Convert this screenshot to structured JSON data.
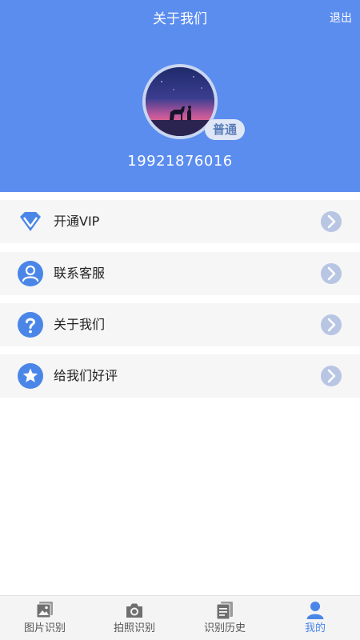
{
  "header": {
    "title": "关于我们",
    "logout_label": "退出"
  },
  "profile": {
    "level_badge": "普通",
    "phone": "19921876016"
  },
  "menu": {
    "items": [
      {
        "label": "开通VIP",
        "icon": "diamond-icon"
      },
      {
        "label": "联系客服",
        "icon": "user-icon"
      },
      {
        "label": "关于我们",
        "icon": "question-icon"
      },
      {
        "label": "给我们好评",
        "icon": "star-icon"
      }
    ]
  },
  "tabbar": {
    "tabs": [
      {
        "label": "图片识别",
        "icon": "image-icon"
      },
      {
        "label": "拍照识别",
        "icon": "camera-icon"
      },
      {
        "label": "识别历史",
        "icon": "history-icon"
      },
      {
        "label": "我的",
        "icon": "profile-icon",
        "active": true
      }
    ]
  },
  "colors": {
    "header_bg": "#5b8def",
    "accent": "#4a86e8",
    "chevron_bg": "#b8c6e4"
  }
}
